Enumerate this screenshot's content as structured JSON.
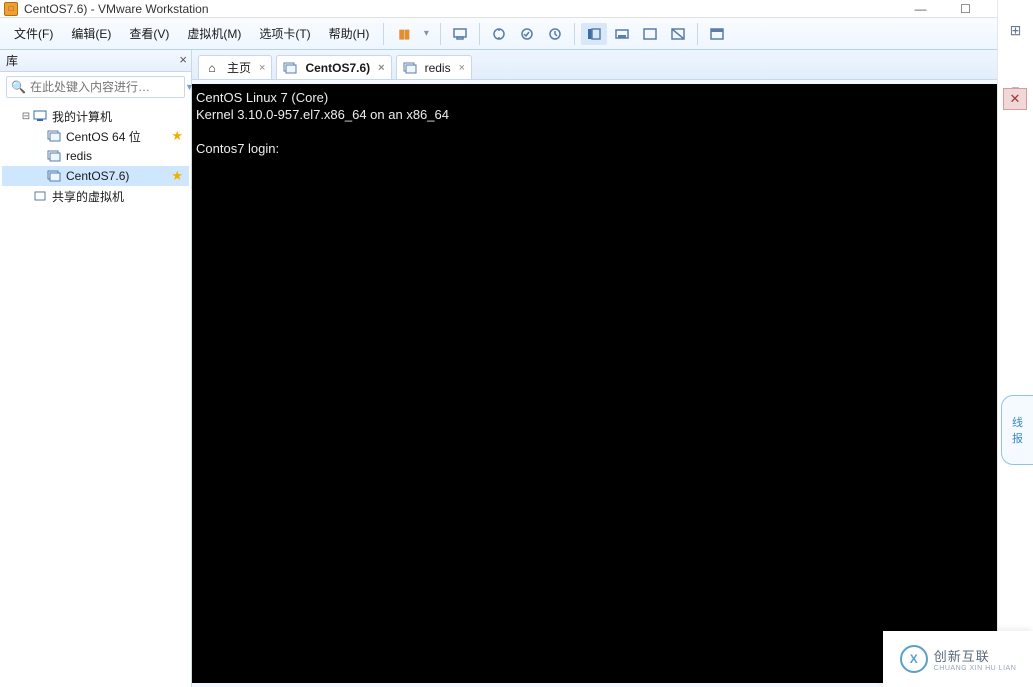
{
  "window": {
    "title": "CentOS7.6) - VMware Workstation"
  },
  "menu": {
    "file": "文件(F)",
    "edit": "编辑(E)",
    "view": "查看(V)",
    "vm": "虚拟机(M)",
    "tabs": "选项卡(T)",
    "help": "帮助(H)"
  },
  "library": {
    "title": "库",
    "search_placeholder": "在此处键入内容进行…",
    "root": "我的计算机",
    "items": [
      "CentOS 64 位",
      "redis",
      "CentOS7.6)"
    ],
    "shared": "共享的虚拟机"
  },
  "tabs": {
    "home": "主页",
    "t1": "CentOS7.6)",
    "t2": "redis"
  },
  "console": {
    "line1": "CentOS Linux 7 (Core)",
    "line2": "Kernel 3.10.0-957.el7.x86_64 on an x86_64",
    "line3": "",
    "line4": "Contos7 login:"
  },
  "floater": {
    "l1": "线",
    "l2": "报"
  },
  "brand": {
    "name": "创新互联",
    "sub": "CHUANG XIN HU LIAN"
  }
}
